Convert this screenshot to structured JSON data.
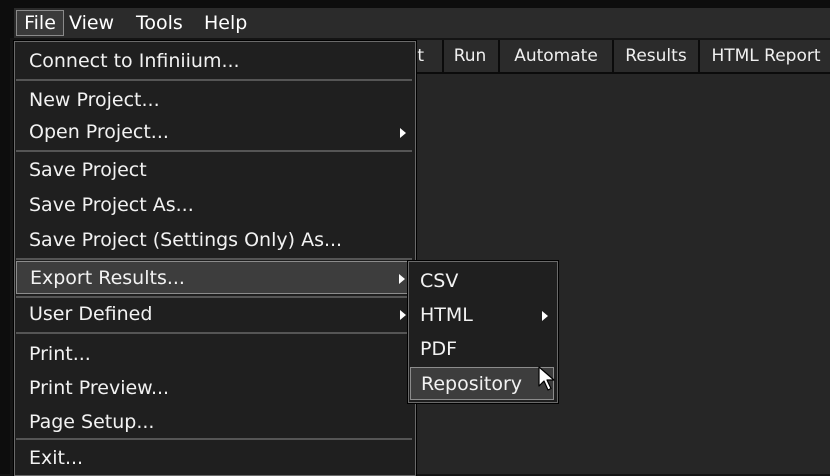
{
  "menubar": {
    "items": [
      "File",
      "View",
      "Tools",
      "Help"
    ]
  },
  "tabs": [
    "ct",
    "Run",
    "Automate",
    "Results",
    "HTML Report"
  ],
  "file_menu": {
    "connect": "Connect to Infiniium...",
    "new_project": "New Project...",
    "open_project": "Open Project...",
    "save_project": "Save Project",
    "save_project_as": "Save Project As...",
    "save_settings_only": "Save Project (Settings Only) As...",
    "export_results": "Export Results...",
    "user_defined": "User Defined",
    "print": "Print...",
    "print_preview": "Print Preview...",
    "page_setup": "Page Setup...",
    "exit": "Exit..."
  },
  "export_submenu": {
    "csv": "CSV",
    "html": "HTML",
    "pdf": "PDF",
    "repository": "Repository"
  }
}
